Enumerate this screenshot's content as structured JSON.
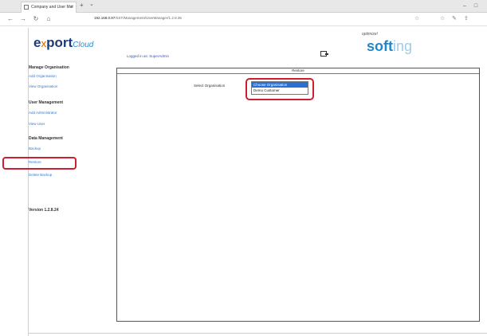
{
  "browser": {
    "tab_title": "Company and User Mar",
    "tab_close": "×",
    "new_tab": "+",
    "tab_dropdown": "⌄",
    "window_minimize": "–",
    "window_maximize": "□",
    "back": "←",
    "forward": "→",
    "refresh": "↻",
    "home": "⌂",
    "address_host": "192.168.0.87",
    "address_path": "/SST/Management/UserManager/1.2.8.36",
    "favorite": "☆",
    "favorites_bar": "☆",
    "notes": "✎",
    "share": "⇪"
  },
  "header": {
    "logo": {
      "e": "e",
      "x": "X",
      "port": "port",
      "cloud": "Cloud"
    },
    "logged_in_text": "Logged in as:  SuperAdmin",
    "brand_tagline": "optimize!",
    "brand_main": "soft",
    "brand_tail": "ing"
  },
  "sidebar": {
    "manage_heading": "Manage Organisation",
    "add_org": "Add Organisation",
    "view_orgs": "View Organisation",
    "user_heading": "User Management",
    "add_admin": "Add Administrator",
    "view_user": "View User",
    "data_heading": "Data Management",
    "backup": "Backup",
    "restore": "Restore",
    "delete_backup": "Delete Backup",
    "version": "Version 1.2.8.24"
  },
  "main": {
    "title": "Restore",
    "select_label": "Select Organisation",
    "options": [
      "Choose Organisation",
      "Demo Customer"
    ]
  },
  "colors": {
    "callout": "#cc1f2f",
    "link": "#3b78c9",
    "selected": "#2b6fcf",
    "brand": "#2286c9",
    "logo_dark": "#1b3c7a",
    "logo_orange": "#e07b1a"
  }
}
